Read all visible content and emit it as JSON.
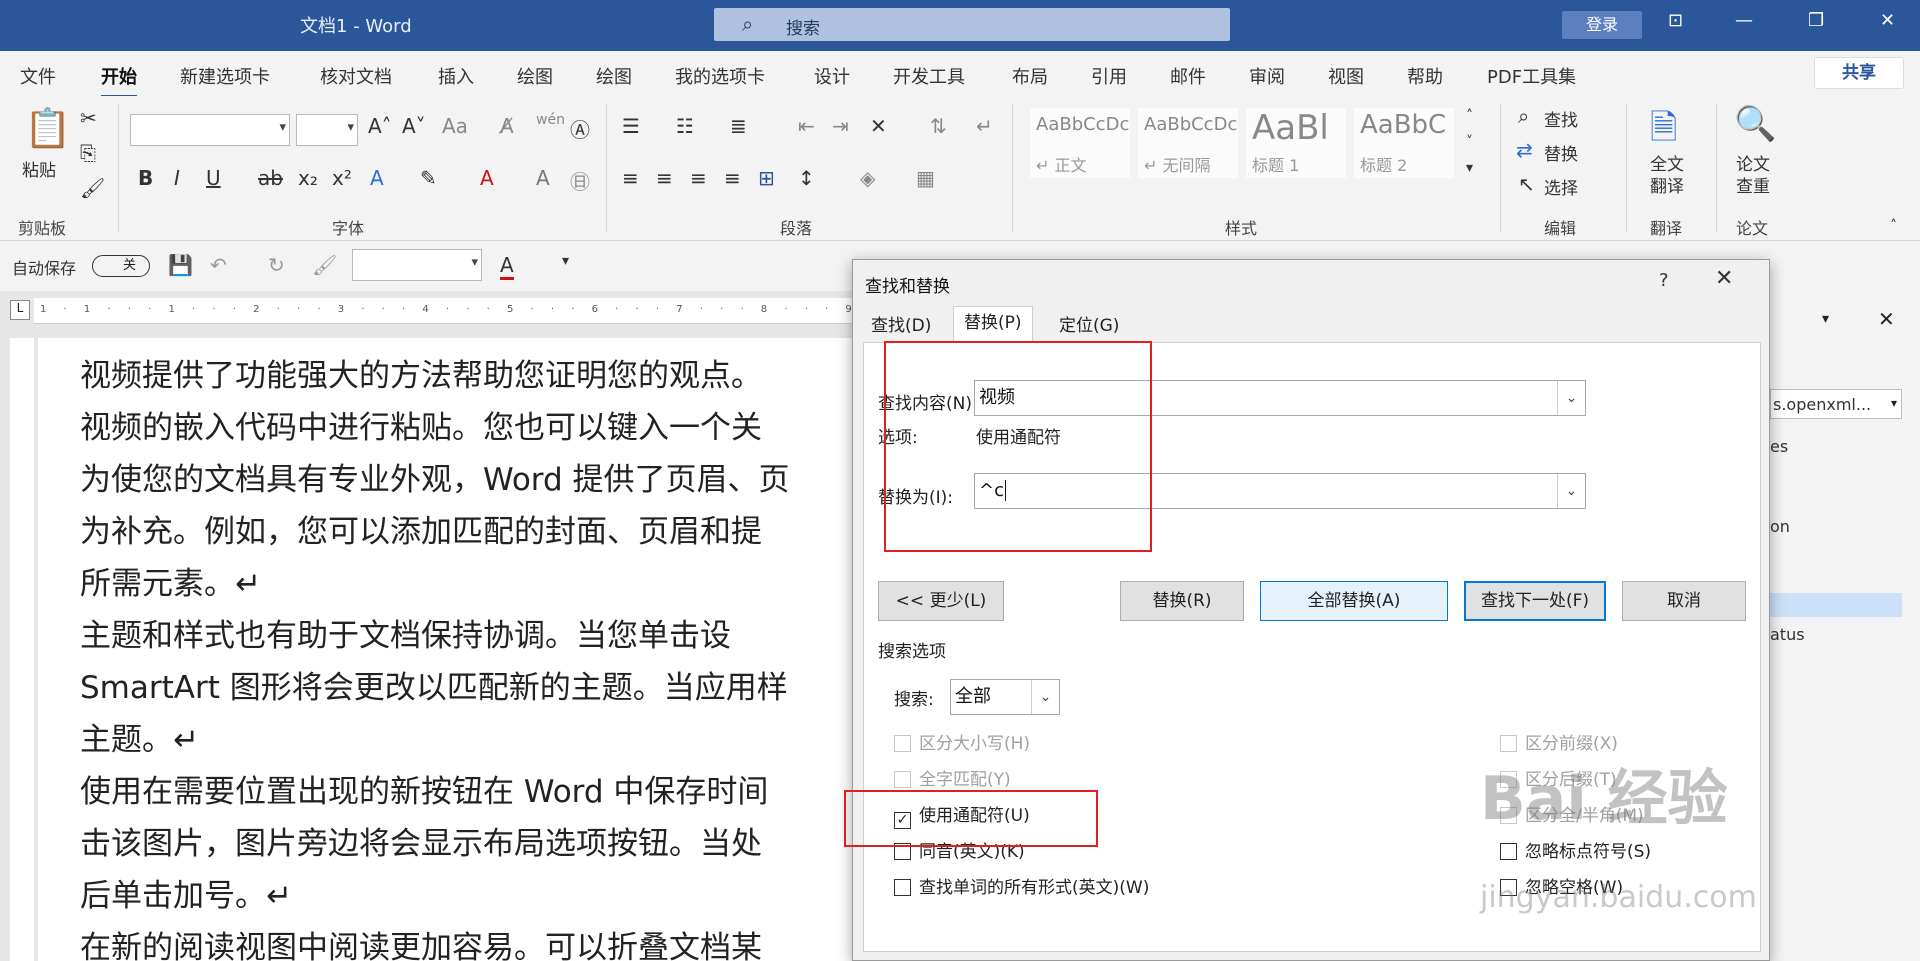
{
  "app": {
    "title": "文档1  -  Word",
    "search_placeholder": "搜索",
    "login": "登录"
  },
  "menu": {
    "tabs": [
      "文件",
      "开始",
      "新建选项卡",
      "核对文档",
      "插入",
      "绘图",
      "绘图",
      "我的选项卡",
      "设计",
      "开发工具",
      "布局",
      "引用",
      "邮件",
      "审阅",
      "视图",
      "帮助",
      "PDF工具集"
    ],
    "active": "开始",
    "share": "共享"
  },
  "ribbon": {
    "groups": [
      "剪贴板",
      "字体",
      "段落",
      "样式",
      "编辑",
      "翻译",
      "论文"
    ],
    "paste": "粘贴",
    "styles": [
      {
        "preview": "AaBbCcDc",
        "name": "↵ 正文"
      },
      {
        "preview": "AaBbCcDc",
        "name": "↵ 无间隔"
      },
      {
        "preview": "AaBl",
        "name": "标题 1"
      },
      {
        "preview": "AaBbC",
        "name": "标题 2"
      }
    ],
    "edit": {
      "find": "查找",
      "replace": "替换",
      "select": "选择"
    },
    "translate": "全文\n翻译",
    "paper": "论文\n查重"
  },
  "qat": {
    "autosave": "自动保存",
    "toggle": "关"
  },
  "document": {
    "lines": [
      "视频提供了功能强大的方法帮助您证明您的观点。",
      "视频的嵌入代码中进行粘贴。您也可以键入一个关",
      "为使您的文档具有专业外观，Word 提供了页眉、页",
      "为补充。例如，您可以添加匹配的封面、页眉和提",
      "所需元素。↵",
      "主题和样式也有助于文档保持协调。当您单击设",
      "SmartArt 图形将会更改以匹配新的主题。当应用样",
      "主题。↵",
      "使用在需要位置出现的新按钮在 Word 中保存时间",
      "击该图片，图片旁边将会显示布局选项按钮。当处",
      "后单击加号。↵",
      "在新的阅读视图中阅读更加容易。可以折叠文档某"
    ]
  },
  "side_pane": {
    "lines": [
      "s.openxml...",
      "es",
      "on",
      "atus"
    ]
  },
  "dialog": {
    "title": "查找和替换",
    "help": "?",
    "tabs": [
      "查找(D)",
      "替换(P)",
      "定位(G)"
    ],
    "find_label": "查找内容(N):",
    "find_value": "视频",
    "options_label": "选项:",
    "options_value": "使用通配符",
    "replace_label": "替换为(I):",
    "replace_value": "^c",
    "buttons": {
      "less": "<< 更少(L)",
      "replace": "替换(R)",
      "replace_all": "全部替换(A)",
      "find_next": "查找下一处(F)",
      "cancel": "取消"
    },
    "search_options": "搜索选项",
    "search_label": "搜索:",
    "search_value": "全部",
    "left_checks": [
      {
        "label": "区分大小写(H)",
        "checked": false,
        "disabled": true
      },
      {
        "label": "全字匹配(Y)",
        "checked": false,
        "disabled": true
      },
      {
        "label": "使用通配符(U)",
        "checked": true,
        "disabled": false
      },
      {
        "label": "同音(英文)(K)",
        "checked": false,
        "disabled": false
      },
      {
        "label": "查找单词的所有形式(英文)(W)",
        "checked": false,
        "disabled": false
      }
    ],
    "right_checks": [
      {
        "label": "区分前缀(X)",
        "checked": false,
        "disabled": true
      },
      {
        "label": "区分后缀(T)",
        "checked": false,
        "disabled": true
      },
      {
        "label": "区分全/半角(M)",
        "checked": false,
        "disabled": true
      },
      {
        "label": "忽略标点符号(S)",
        "checked": false,
        "disabled": false
      },
      {
        "label": "忽略空格(W)",
        "checked": false,
        "disabled": false
      }
    ]
  },
  "watermark": {
    "brand": "Bai 经验",
    "url": "jingyan.baidu.com"
  },
  "colors": {
    "titlebar": "#2b579a",
    "highlight": "#e02020"
  }
}
